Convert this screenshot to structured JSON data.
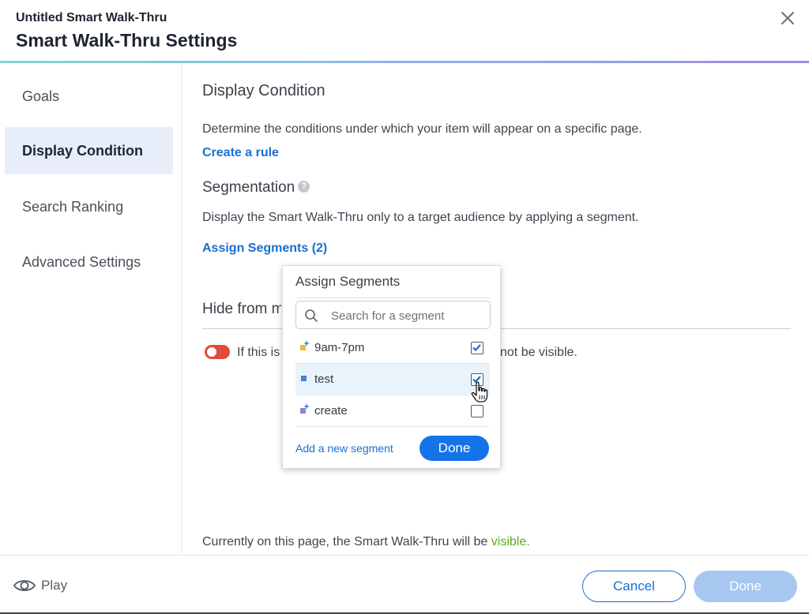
{
  "header": {
    "subtitle": "Untitled Smart Walk-Thru",
    "title": "Smart Walk-Thru Settings"
  },
  "sidebar": {
    "items": [
      {
        "label": "Goals",
        "active": false
      },
      {
        "label": "Display Condition",
        "active": true
      },
      {
        "label": "Search Ranking",
        "active": false
      },
      {
        "label": "Advanced Settings",
        "active": false
      }
    ]
  },
  "main": {
    "display_heading": "Display Condition",
    "display_desc": "Determine the conditions under which your item will appear on a specific page.",
    "create_rule": "Create a rule",
    "segmentation_heading": "Segmentation",
    "segmentation_desc": "Display the Smart Walk-Thru only to a target audience by applying a segment.",
    "assign_segments": "Assign Segments (2)",
    "hide_heading": "Hide from m",
    "toggle_text_start": "If this is",
    "toggle_text_end": "not be visible.",
    "status_prefix": "Currently on this page, the Smart Walk-Thru will be ",
    "status_word": "visible."
  },
  "popover": {
    "title": "Assign Segments",
    "search_placeholder": "Search for a segment",
    "segments": [
      {
        "name": "9am-7pm",
        "checked": true,
        "icon": "segment-sparkle-icon",
        "color": "#f5b82e"
      },
      {
        "name": "test",
        "checked": true,
        "icon": "segment-square-icon",
        "color": "#4a7fe0"
      },
      {
        "name": "create",
        "checked": false,
        "icon": "segment-sparkle-icon",
        "color": "#9b7fd6"
      }
    ],
    "add_new": "Add a new segment",
    "done": "Done"
  },
  "footer": {
    "play": "Play",
    "cancel": "Cancel",
    "done": "Done"
  },
  "colors": {
    "accent": "#1a6fd1",
    "toggle_off": "#e24a3b",
    "visible": "#5cab18",
    "done_disabled": "#a7c7f0"
  }
}
